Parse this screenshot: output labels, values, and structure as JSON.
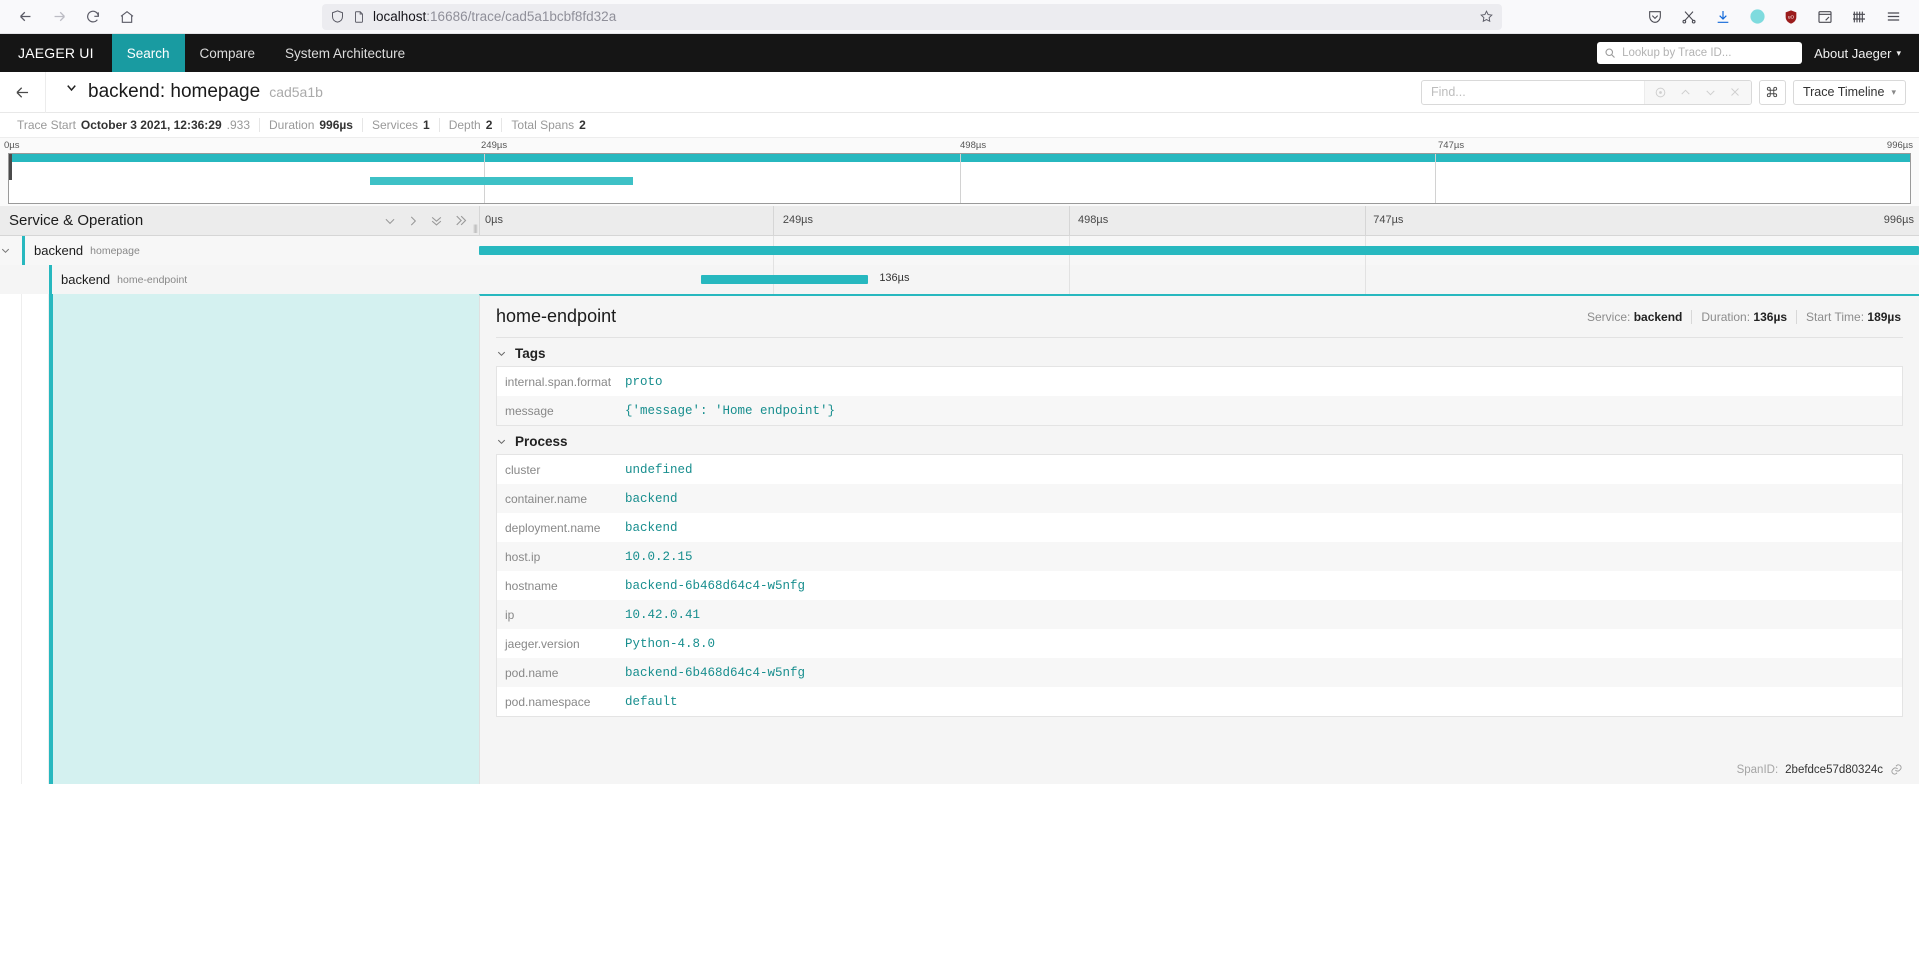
{
  "browser": {
    "url_host": "localhost",
    "url_rest": ":16686/trace/cad5a1bcbf8fd32a",
    "back_icon": "back-arrow-icon",
    "forward_icon": "forward-arrow-icon",
    "reload_icon": "reload-icon",
    "home_icon": "home-icon",
    "shield_icon": "shield-icon",
    "page_icon": "page-icon",
    "bookmark_icon": "star-icon",
    "toolbar_icons": [
      "pocket-icon",
      "screenshot-icon",
      "downloads-icon",
      "account-icon",
      "ublock-icon",
      "reader-icon",
      "library-icon",
      "menu-icon"
    ]
  },
  "nav": {
    "brand": "JAEGER UI",
    "tabs": [
      {
        "label": "Search",
        "active": true
      },
      {
        "label": "Compare",
        "active": false
      },
      {
        "label": "System Architecture",
        "active": false
      }
    ],
    "lookup_placeholder": "Lookup by Trace ID...",
    "about_label": "About Jaeger",
    "accent": "#199ba1"
  },
  "trace_header": {
    "title": "backend: homepage",
    "trace_id": "cad5a1b",
    "find_placeholder": "Find...",
    "view_mode": "Trace Timeline",
    "shortcut_icon": "command-key-icon"
  },
  "trace_meta": [
    {
      "label": "Trace Start",
      "value": "October 3 2021, 12:36:29",
      "frac": ".933"
    },
    {
      "label": "Duration",
      "value": "996µs",
      "frac": ""
    },
    {
      "label": "Services",
      "value": "1",
      "frac": ""
    },
    {
      "label": "Depth",
      "value": "2",
      "frac": ""
    },
    {
      "label": "Total Spans",
      "value": "2",
      "frac": ""
    }
  ],
  "minimap": {
    "ticks": [
      "0µs",
      "249µs",
      "498µs",
      "747µs",
      "996µs"
    ],
    "tick_positions_pct": [
      0,
      25,
      50,
      75,
      100
    ],
    "spans": [
      {
        "left_pct": 0,
        "width_pct": 100,
        "row": 0
      },
      {
        "left_pct": 19.0,
        "width_pct": 13.8,
        "row": 1
      }
    ]
  },
  "timeline": {
    "column_header": "Service & Operation",
    "collapse_icons": [
      "chevron-down-icon",
      "chevron-right-icon",
      "double-chevron-down-icon",
      "double-chevron-right-icon"
    ],
    "ticks": [
      "0µs",
      "249µs",
      "498µs",
      "747µs",
      "996µs"
    ],
    "tick_positions_pct": [
      0,
      25,
      50,
      75,
      100
    ],
    "rows": [
      {
        "service": "backend",
        "operation": "homepage",
        "depth": 0,
        "expanded": true,
        "bar_left_pct": 0,
        "bar_width_pct": 100,
        "bar_label": ""
      },
      {
        "service": "backend",
        "operation": "home-endpoint",
        "depth": 1,
        "expanded": false,
        "bar_left_pct": 19.0,
        "bar_width_pct": 13.7,
        "bar_label": "136µs"
      }
    ]
  },
  "span_detail": {
    "title": "home-endpoint",
    "service_label": "Service:",
    "service_value": "backend",
    "duration_label": "Duration:",
    "duration_value": "136µs",
    "start_label": "Start Time:",
    "start_value": "189µs",
    "tags_section": {
      "title": "Tags",
      "rows": [
        {
          "key": "internal.span.format",
          "value": "proto"
        },
        {
          "key": "message",
          "value": "{'message': 'Home endpoint'}"
        }
      ]
    },
    "process_section": {
      "title": "Process",
      "rows": [
        {
          "key": "cluster",
          "value": "undefined"
        },
        {
          "key": "container.name",
          "value": "backend"
        },
        {
          "key": "deployment.name",
          "value": "backend"
        },
        {
          "key": "host.ip",
          "value": "10.0.2.15"
        },
        {
          "key": "hostname",
          "value": "backend-6b468d64c4-w5nfg"
        },
        {
          "key": "ip",
          "value": "10.42.0.41"
        },
        {
          "key": "jaeger.version",
          "value": "Python-4.8.0"
        },
        {
          "key": "pod.name",
          "value": "backend-6b468d64c4-w5nfg"
        },
        {
          "key": "pod.namespace",
          "value": "default"
        }
      ]
    },
    "span_id_label": "SpanID:",
    "span_id_value": "2befdce57d80324c",
    "link_icon": "link-icon"
  },
  "colors": {
    "accent_teal": "#27b8bf",
    "nav_active": "#199ba1",
    "value_text": "#178e8e",
    "highlight_fill": "#d4f1f0"
  }
}
